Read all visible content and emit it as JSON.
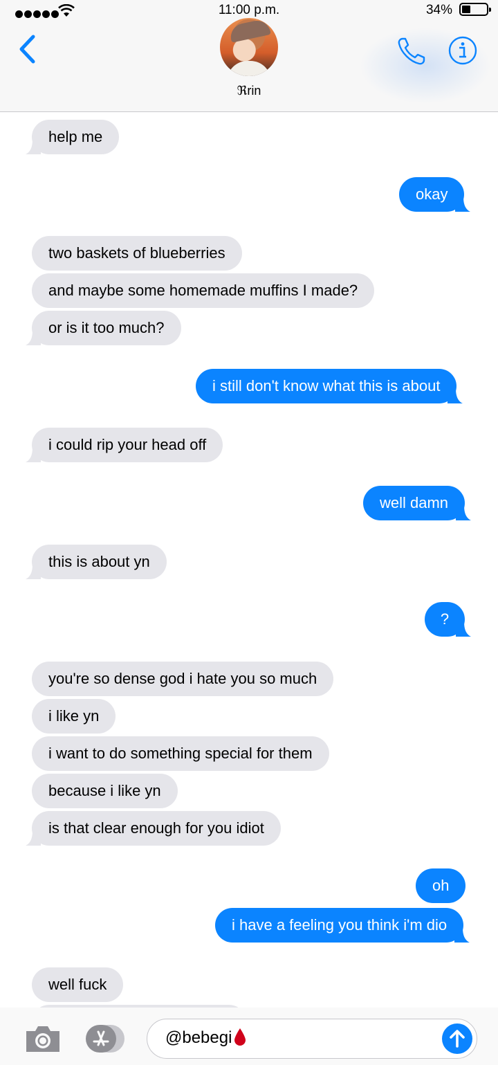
{
  "status_bar": {
    "time": "11:00 p.m.",
    "battery": "34%"
  },
  "contact": {
    "name": "ℜrin"
  },
  "messages": [
    {
      "side": "recv",
      "text": "help me"
    },
    {
      "side": "sent",
      "text": "okay"
    },
    {
      "side": "recv",
      "text": "two baskets of blueberries"
    },
    {
      "side": "recv",
      "text": "and maybe some homemade muffins I made?"
    },
    {
      "side": "recv",
      "text": "or is it too much?"
    },
    {
      "side": "sent",
      "text": "i still don't know what this is about"
    },
    {
      "side": "recv",
      "text": "i could rip your head off"
    },
    {
      "side": "sent",
      "text": "well damn"
    },
    {
      "side": "recv",
      "text": "this is about yn"
    },
    {
      "side": "sent",
      "text": "?"
    },
    {
      "side": "recv",
      "text": "you're so dense god i hate you so much"
    },
    {
      "side": "recv",
      "text": "i like yn"
    },
    {
      "side": "recv",
      "text": "i want to do something special for them"
    },
    {
      "side": "recv",
      "text": "because i like yn"
    },
    {
      "side": "recv",
      "text": "is that clear enough for you idiot"
    },
    {
      "side": "sent",
      "text": "oh"
    },
    {
      "side": "sent",
      "text": "i have a feeling you think i'm dio"
    },
    {
      "side": "recv",
      "text": "well fuck"
    }
  ],
  "composer": {
    "text": "@bebegi"
  },
  "colors": {
    "sent": "#0b84ff",
    "received": "#e5e5ea",
    "accent": "#0b84ff"
  }
}
